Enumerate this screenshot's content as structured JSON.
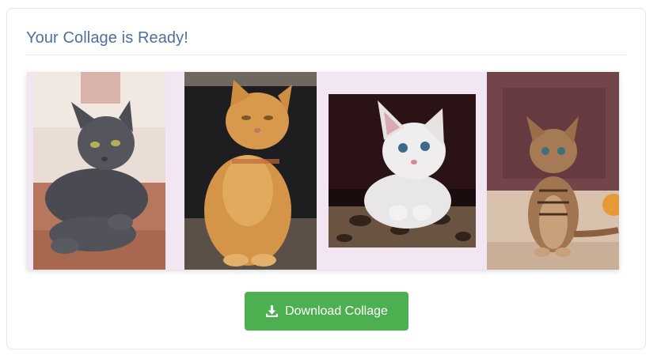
{
  "card": {
    "title": "Your Collage is Ready!"
  },
  "collage": {
    "photos": [
      {
        "name": "gray cat lying",
        "icon": "gray-cat-photo"
      },
      {
        "name": "orange tabby cat sitting",
        "icon": "orange-cat-photo"
      },
      {
        "name": "white kitten in basket",
        "icon": "white-kitten-photo"
      },
      {
        "name": "tabby kitten sitting",
        "icon": "tabby-kitten-photo"
      }
    ],
    "background_color": "#f3e6f3"
  },
  "actions": {
    "download_label": "Download Collage",
    "download_icon": "download-icon",
    "button_color": "#4caf50"
  },
  "colors": {
    "title": "#4f6f9f"
  }
}
